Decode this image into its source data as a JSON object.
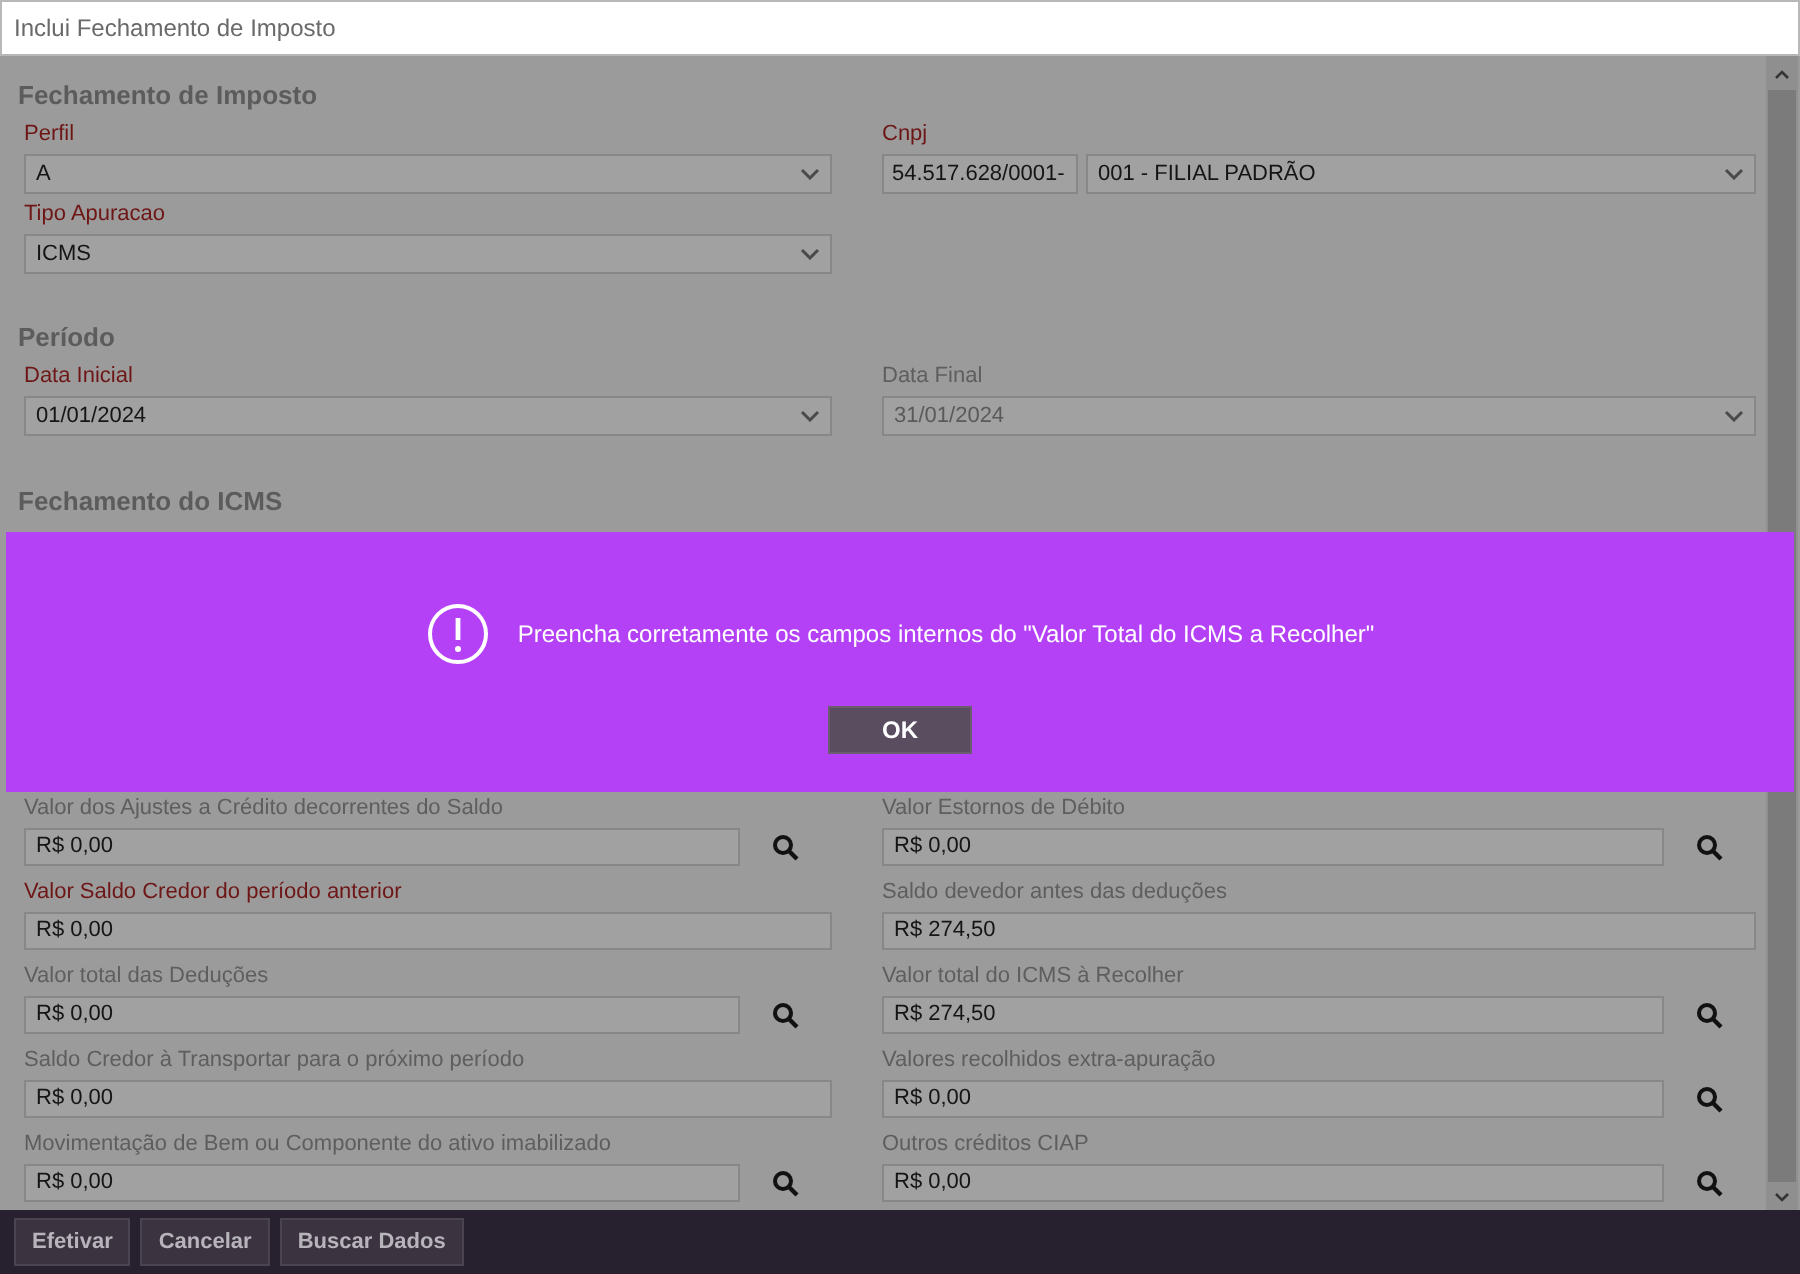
{
  "window": {
    "title": "Inclui Fechamento de Imposto"
  },
  "sections": [
    {
      "title": "Fechamento de Imposto"
    },
    {
      "title": "Período"
    },
    {
      "title": "Fechamento do ICMS"
    }
  ],
  "perfil": {
    "label": "Perfil",
    "required": true,
    "value": "A",
    "disabled": false
  },
  "cnpj": {
    "label": "Cnpj",
    "required": true,
    "number": "54.517.628/0001-",
    "value": "001 - FILIAL PADRÃO",
    "disabled": false
  },
  "tipo_apuracao": {
    "label": "Tipo Apuracao",
    "required": true,
    "value": "ICMS",
    "disabled": false
  },
  "data_inicial": {
    "label": "Data Inicial",
    "required": true,
    "value": "01/01/2024",
    "disabled": false
  },
  "data_final": {
    "label": "Data Final",
    "required": false,
    "value": "31/01/2024",
    "disabled": true
  },
  "icms_fields": [
    {
      "label": "Valor dos Ajustes a Crédito decorrentes do Saldo",
      "required": false,
      "value": "R$ 0,00",
      "search": true
    },
    {
      "label": "Valor Estornos de Débito",
      "required": false,
      "value": "R$ 0,00",
      "search": true
    },
    {
      "label": "Valor Saldo Credor do período anterior",
      "required": true,
      "value": "R$ 0,00",
      "search": false
    },
    {
      "label": "Saldo devedor antes das deduções",
      "required": false,
      "value": "R$ 274,50",
      "search": false
    },
    {
      "label": "Valor total das Deduções",
      "required": false,
      "value": "R$ 0,00",
      "search": true
    },
    {
      "label": "Valor total do ICMS à Recolher",
      "required": false,
      "value": "R$ 274,50",
      "search": true
    },
    {
      "label": "Saldo Credor à Transportar para o próximo período",
      "required": false,
      "value": "R$ 0,00",
      "search": false
    },
    {
      "label": "Valores recolhidos extra-apuração",
      "required": false,
      "value": "R$ 0,00",
      "search": true
    },
    {
      "label": "Movimentação de Bem ou Componente do ativo imabilizado",
      "required": false,
      "value": "R$ 0,00",
      "search": true
    },
    {
      "label": "Outros créditos CIAP",
      "required": false,
      "value": "R$ 0,00",
      "search": true
    }
  ],
  "alert": {
    "message": "Preencha corretamente os campos internos do \"Valor Total do ICMS a Recolher\"",
    "button": "OK"
  },
  "footer_buttons": [
    "Efetivar",
    "Cancelar",
    "Buscar Dados"
  ]
}
